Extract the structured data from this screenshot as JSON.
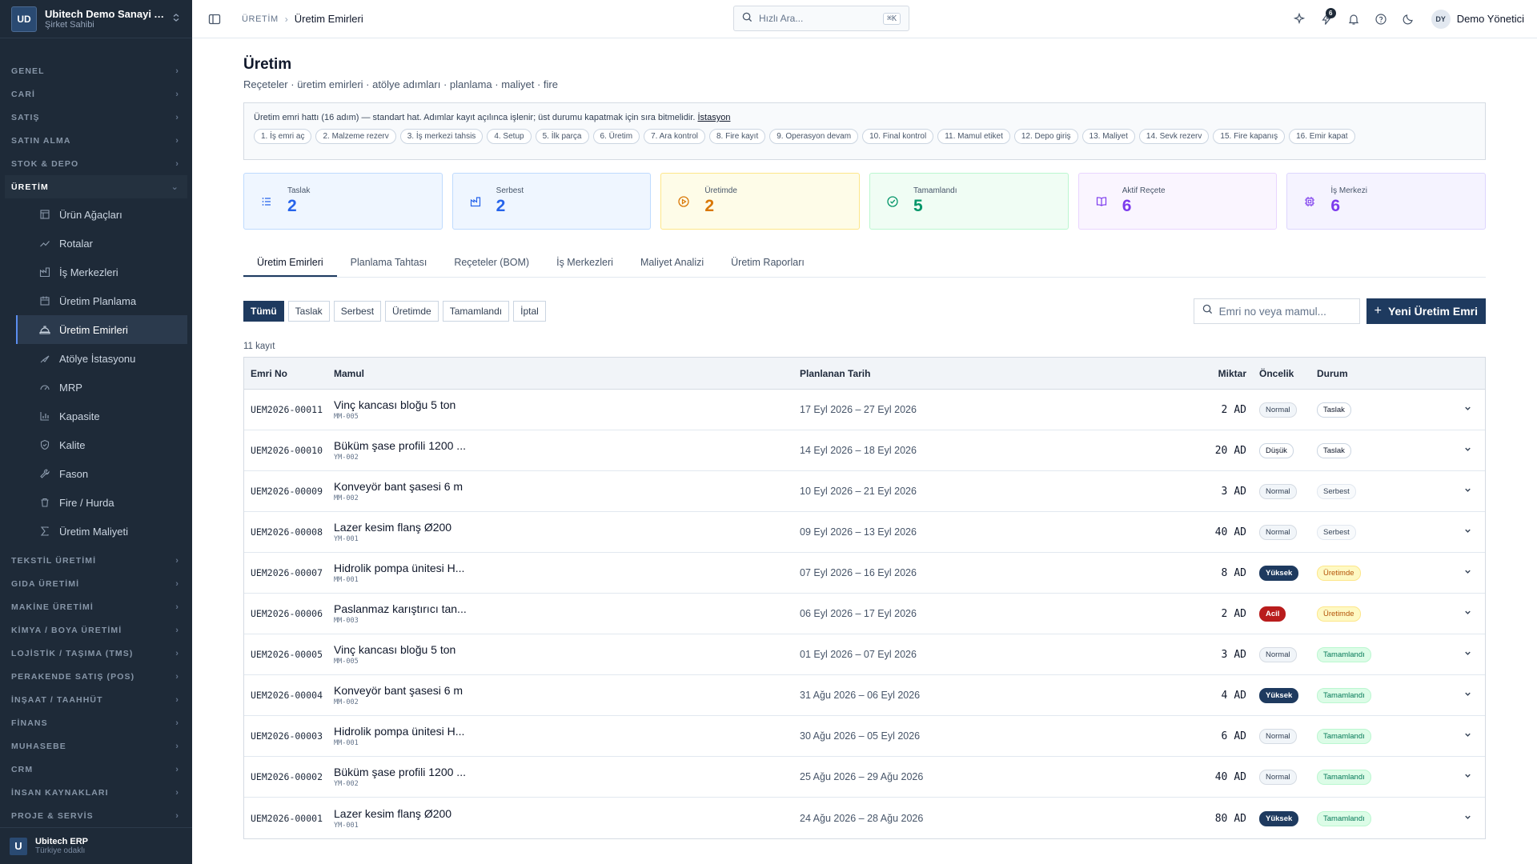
{
  "sidebar": {
    "logo": "UD",
    "company": "Ubitech Demo Sanayi A.Ş.",
    "role": "Şirket Sahibi",
    "sections_before": [
      "GENEL",
      "CARİ",
      "SATIŞ",
      "SATIN ALMA",
      "STOK & DEPO"
    ],
    "open_section": "ÜRETİM",
    "items": [
      {
        "label": "Ürün Ağaçları",
        "icon": "tree-icon"
      },
      {
        "label": "Rotalar",
        "icon": "route-icon"
      },
      {
        "label": "İş Merkezleri",
        "icon": "factory-icon"
      },
      {
        "label": "Üretim Planlama",
        "icon": "calendar-icon"
      },
      {
        "label": "Üretim Emirleri",
        "icon": "hardhat-icon",
        "active": true
      },
      {
        "label": "Atölye İstasyonu",
        "icon": "station-icon"
      },
      {
        "label": "MRP",
        "icon": "gauge-icon"
      },
      {
        "label": "Kapasite",
        "icon": "chart-icon"
      },
      {
        "label": "Kalite",
        "icon": "shield-icon"
      },
      {
        "label": "Fason",
        "icon": "wrench-icon"
      },
      {
        "label": "Fire / Hurda",
        "icon": "trash-icon"
      },
      {
        "label": "Üretim Maliyeti",
        "icon": "sigma-icon"
      }
    ],
    "sections_after": [
      "TEKSTİL ÜRETİMİ",
      "GIDA ÜRETİMİ",
      "MAKİNE ÜRETİMİ",
      "KİMYA / BOYA ÜRETİMİ",
      "LOJİSTİK / TAŞIMA (TMS)",
      "PERAKENDE SATIŞ (POS)",
      "İNŞAAT / TAAHHÜT",
      "FİNANS",
      "MUHASEBE",
      "CRM",
      "İNSAN KAYNAKLARI",
      "PROJE & SERVİS"
    ],
    "footer_logo": "U",
    "footer_name": "Ubitech ERP",
    "footer_sub": "Türkiye odaklı"
  },
  "topbar": {
    "crumb_parent": "ÜRETİM",
    "crumb_current": "Üretim Emirleri",
    "search_placeholder": "Hızlı Ara...",
    "search_kbd": "⌘K",
    "notif_count": "6",
    "avatar": "DY",
    "user_name": "Demo Yönetici"
  },
  "page": {
    "title": "Üretim",
    "subtitle": "Reçeteler · üretim emirleri · atölye adımları · planlama · maliyet · fire"
  },
  "flow": {
    "text": "Üretim emri hattı (16 adım) — standart hat. Adımlar kayıt açılınca işlenir; üst durumu kapatmak için sıra bitmelidir.",
    "link": "İstasyon",
    "steps": [
      "1. İş emri aç",
      "2. Malzeme rezerv",
      "3. İş merkezi tahsis",
      "4. Setup",
      "5. İlk parça",
      "6. Üretim",
      "7. Ara kontrol",
      "8. Fire kayıt",
      "9. Operasyon devam",
      "10. Final kontrol",
      "11. Mamul etiket",
      "12. Depo giriş",
      "13. Maliyet",
      "14. Sevk rezerv",
      "15. Fire kapanış",
      "16. Emir kapat"
    ]
  },
  "kpis": [
    {
      "label": "Taslak",
      "value": "2",
      "color": "#2563eb",
      "bg": "#eff6ff",
      "border": "#bfdbfe",
      "icon": "list-icon"
    },
    {
      "label": "Serbest",
      "value": "2",
      "color": "#2563eb",
      "bg": "#eff6ff",
      "border": "#bfdbfe",
      "icon": "factory-icon"
    },
    {
      "label": "Üretimde",
      "value": "2",
      "color": "#d97706",
      "bg": "#fefce8",
      "border": "#fde68a",
      "icon": "play-icon"
    },
    {
      "label": "Tamamlandı",
      "value": "5",
      "color": "#059669",
      "bg": "#f0fdf4",
      "border": "#bbf7d0",
      "icon": "check-icon"
    },
    {
      "label": "Aktif Reçete",
      "value": "6",
      "color": "#7c3aed",
      "bg": "#faf5ff",
      "border": "#e9d5ff",
      "icon": "book-icon"
    },
    {
      "label": "İş Merkezi",
      "value": "6",
      "color": "#7c3aed",
      "bg": "#f5f3ff",
      "border": "#ddd6fe",
      "icon": "cpu-icon"
    }
  ],
  "tabs": [
    "Üretim Emirleri",
    "Planlama Tahtası",
    "Reçeteler (BOM)",
    "İş Merkezleri",
    "Maliyet Analizi",
    "Üretim Raporları"
  ],
  "filters": [
    "Tümü",
    "Taslak",
    "Serbest",
    "Üretimde",
    "Tamamlandı",
    "İptal"
  ],
  "toolbar": {
    "search_placeholder": "Emri no veya mamul...",
    "new_label": "Yeni Üretim Emri"
  },
  "table": {
    "count": "11 kayıt",
    "headers": {
      "no": "Emri No",
      "mamul": "Mamul",
      "tarih": "Planlanan Tarih",
      "miktar": "Miktar",
      "oncelik": "Öncelik",
      "durum": "Durum"
    },
    "rows": [
      {
        "no": "UEM2026-00011",
        "mamul": "Vinç kancası bloğu 5 ton",
        "code": "MM-005",
        "tarih": "17 Eyl 2026 – 27 Eyl 2026",
        "miktar": "2",
        "birim": "AD",
        "oncelik": "Normal",
        "durum": "Taslak"
      },
      {
        "no": "UEM2026-00010",
        "mamul": "Büküm şase profili 1200 ...",
        "code": "YM-002",
        "tarih": "14 Eyl 2026 – 18 Eyl 2026",
        "miktar": "20",
        "birim": "AD",
        "oncelik": "Düşük",
        "durum": "Taslak"
      },
      {
        "no": "UEM2026-00009",
        "mamul": "Konveyör bant şasesi 6 m",
        "code": "MM-002",
        "tarih": "10 Eyl 2026 – 21 Eyl 2026",
        "miktar": "3",
        "birim": "AD",
        "oncelik": "Normal",
        "durum": "Serbest"
      },
      {
        "no": "UEM2026-00008",
        "mamul": "Lazer kesim flanş Ø200",
        "code": "YM-001",
        "tarih": "09 Eyl 2026 – 13 Eyl 2026",
        "miktar": "40",
        "birim": "AD",
        "oncelik": "Normal",
        "durum": "Serbest"
      },
      {
        "no": "UEM2026-00007",
        "mamul": "Hidrolik pompa ünitesi H...",
        "code": "MM-001",
        "tarih": "07 Eyl 2026 – 16 Eyl 2026",
        "miktar": "8",
        "birim": "AD",
        "oncelik": "Yüksek",
        "durum": "Üretimde"
      },
      {
        "no": "UEM2026-00006",
        "mamul": "Paslanmaz karıştırıcı tan...",
        "code": "MM-003",
        "tarih": "06 Eyl 2026 – 17 Eyl 2026",
        "miktar": "2",
        "birim": "AD",
        "oncelik": "Acil",
        "durum": "Üretimde"
      },
      {
        "no": "UEM2026-00005",
        "mamul": "Vinç kancası bloğu 5 ton",
        "code": "MM-005",
        "tarih": "01 Eyl 2026 – 07 Eyl 2026",
        "miktar": "3",
        "birim": "AD",
        "oncelik": "Normal",
        "durum": "Tamamlandı"
      },
      {
        "no": "UEM2026-00004",
        "mamul": "Konveyör bant şasesi 6 m",
        "code": "MM-002",
        "tarih": "31 Ağu 2026 – 06 Eyl 2026",
        "miktar": "4",
        "birim": "AD",
        "oncelik": "Yüksek",
        "durum": "Tamamlandı"
      },
      {
        "no": "UEM2026-00003",
        "mamul": "Hidrolik pompa ünitesi H...",
        "code": "MM-001",
        "tarih": "30 Ağu 2026 – 05 Eyl 2026",
        "miktar": "6",
        "birim": "AD",
        "oncelik": "Normal",
        "durum": "Tamamlandı"
      },
      {
        "no": "UEM2026-00002",
        "mamul": "Büküm şase profili 1200 ...",
        "code": "YM-002",
        "tarih": "25 Ağu 2026 – 29 Ağu 2026",
        "miktar": "40",
        "birim": "AD",
        "oncelik": "Normal",
        "durum": "Tamamlandı"
      },
      {
        "no": "UEM2026-00001",
        "mamul": "Lazer kesim flanş Ø200",
        "code": "YM-001",
        "tarih": "24 Ağu 2026 – 28 Ağu 2026",
        "miktar": "80",
        "birim": "AD",
        "oncelik": "Yüksek",
        "durum": "Tamamlandı"
      }
    ]
  }
}
